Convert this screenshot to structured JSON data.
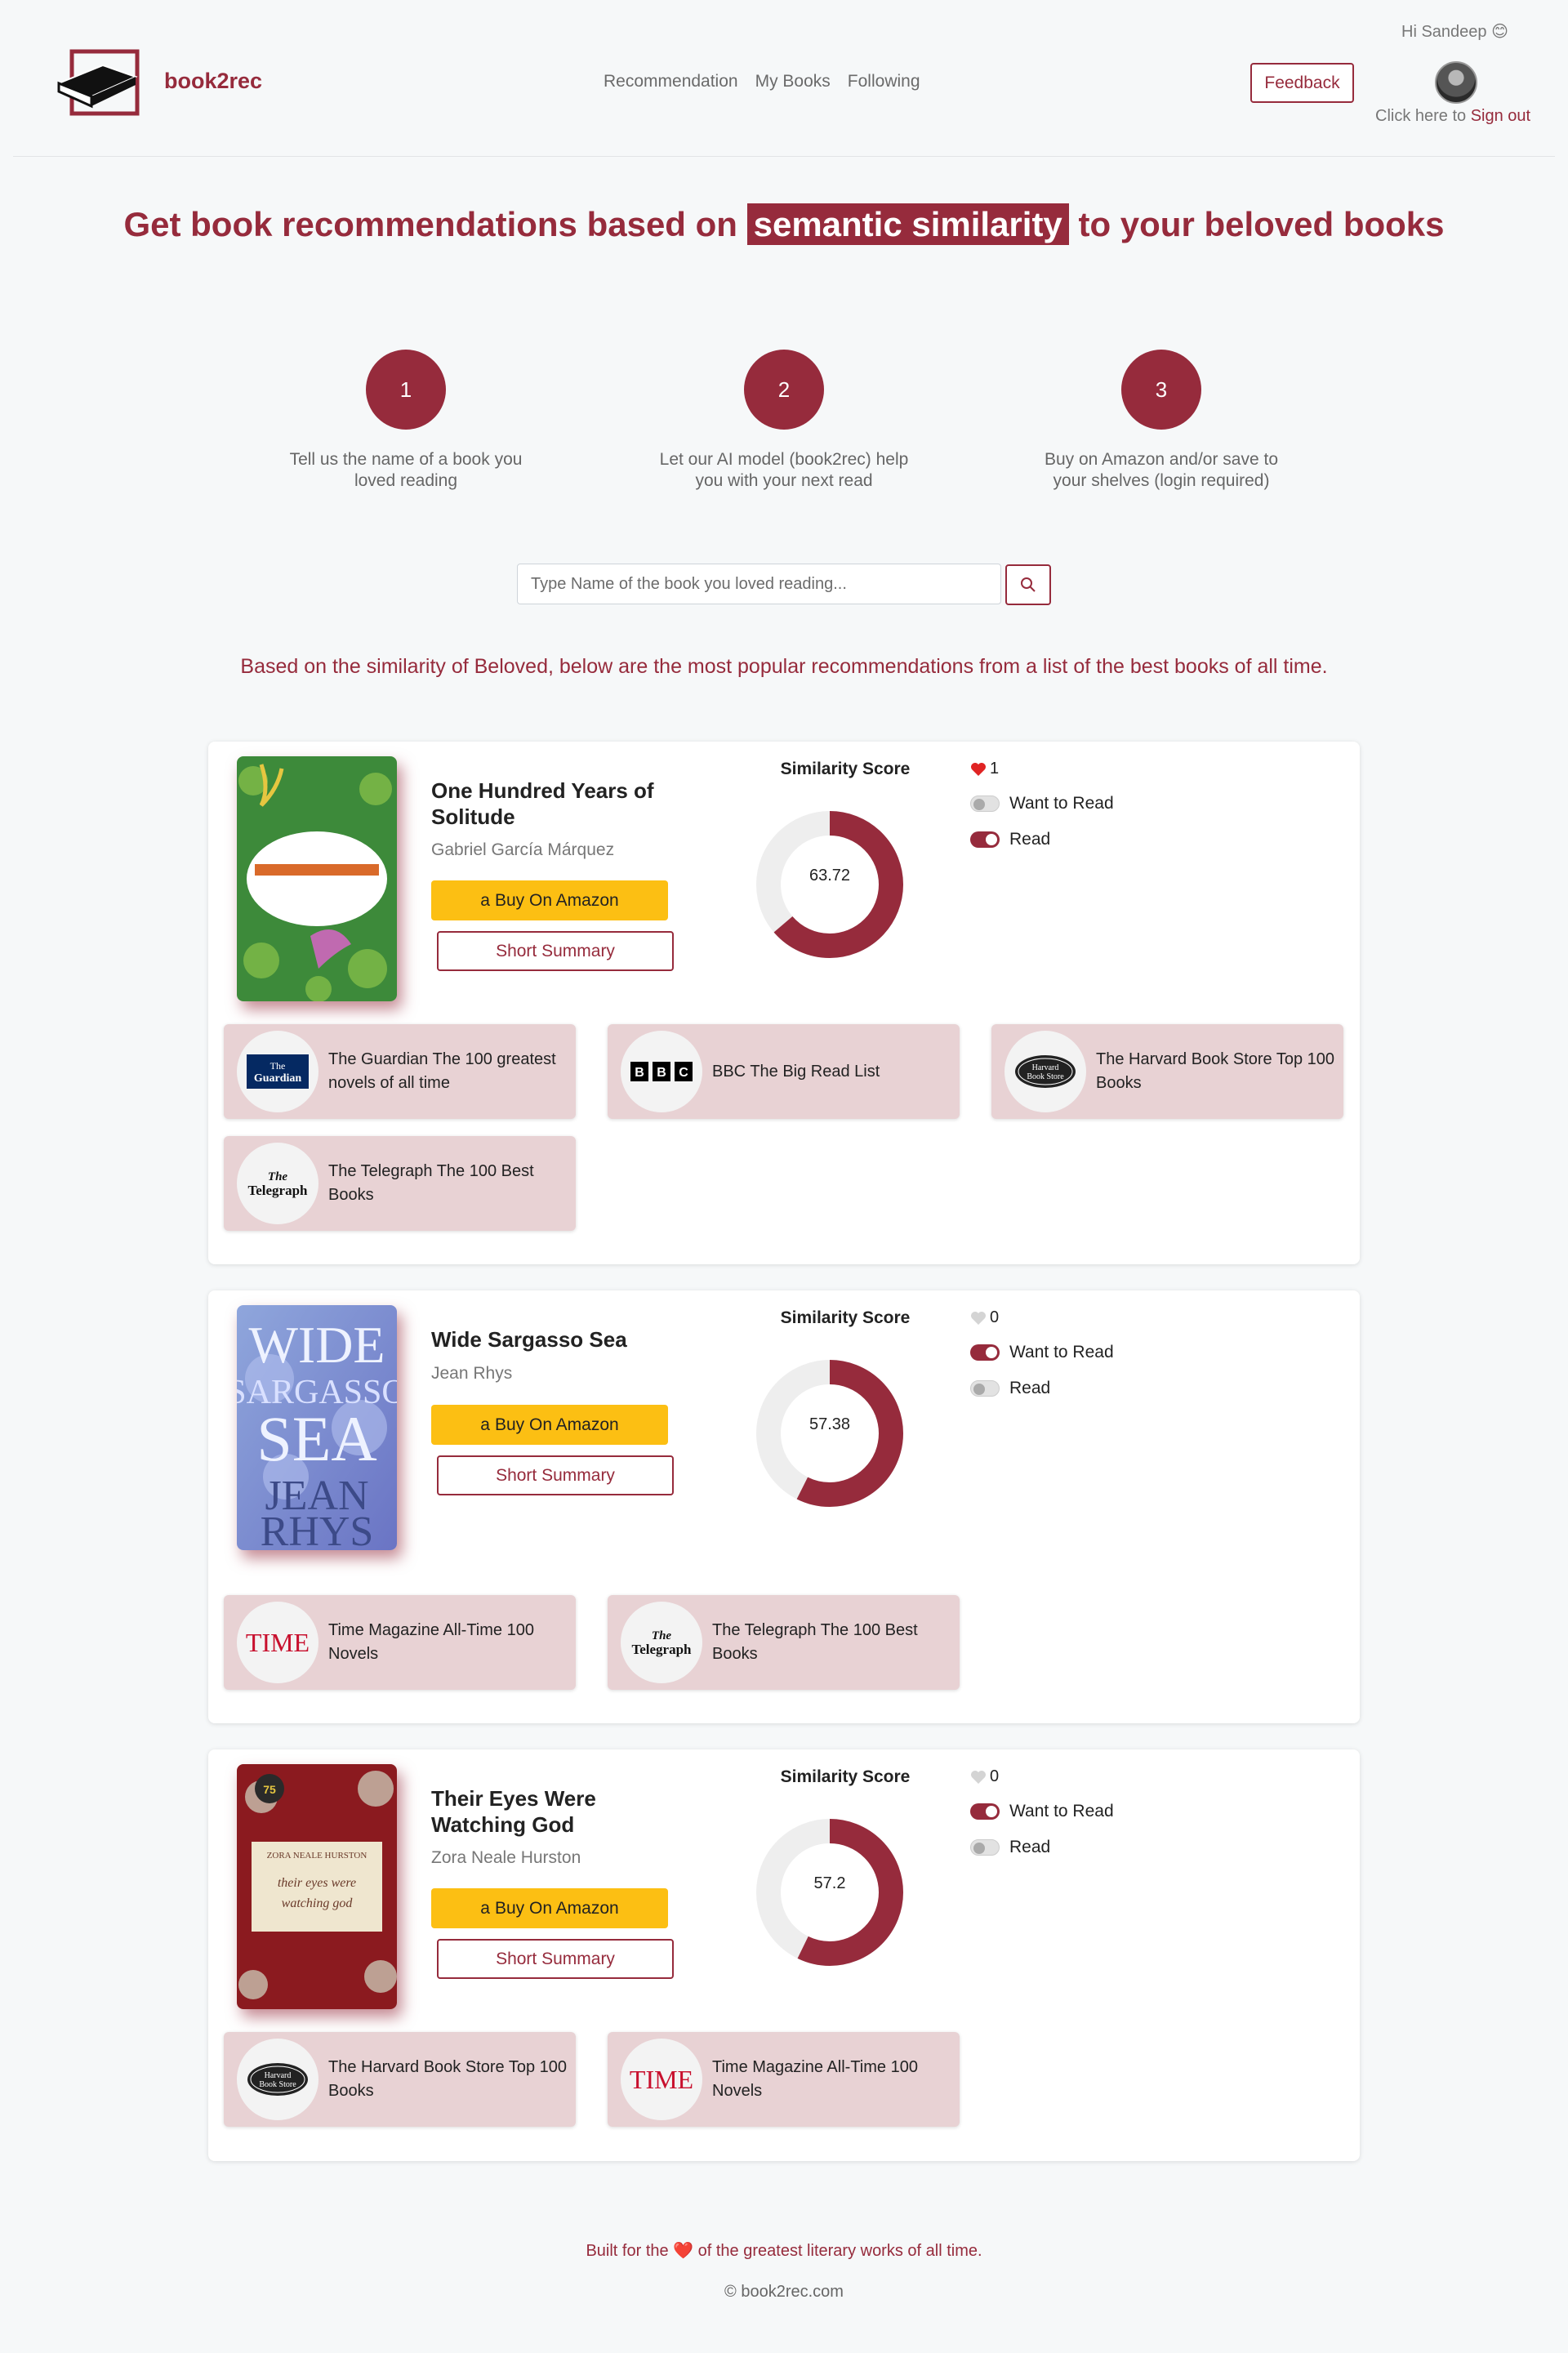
{
  "header": {
    "brand": "book2rec",
    "nav": [
      "Recommendation",
      "My Books",
      "Following"
    ],
    "greeting": "Hi Sandeep 😊",
    "feedback_label": "Feedback",
    "signout_prefix": "Click here to ",
    "signout_link": "Sign out"
  },
  "hero": {
    "title_before": "Get book recommendations based on ",
    "title_highlight": "semantic similarity",
    "title_after": " to your beloved books",
    "steps": [
      {
        "number": "1",
        "text": "Tell us the name of a book you loved reading"
      },
      {
        "number": "2",
        "text": "Let our AI model (book2rec) help you with your next read"
      },
      {
        "number": "3",
        "text": "Buy on Amazon and/or save to your shelves (login required)"
      }
    ]
  },
  "search": {
    "placeholder": "Type Name of the book you loved reading..."
  },
  "based_text": "Based on the similarity of Beloved, below are the most popular recommendations from a list of the best books of all time.",
  "labels": {
    "similarity": "Similarity Score",
    "buy": "Buy On Amazon",
    "summary": "Short Summary",
    "want": "Want to Read",
    "read": "Read"
  },
  "books": [
    {
      "title": "One Hundred Years of Solitude",
      "author": "Gabriel García Márquez",
      "score": 63.72,
      "likes": "1",
      "liked": true,
      "want_to_read": false,
      "read": true,
      "lists": [
        {
          "name": "The Guardian The 100 greatest novels of all time",
          "logo": "guardian-logo"
        },
        {
          "name": "BBC The Big Read List",
          "logo": "bbc-logo"
        },
        {
          "name": "The Harvard Book Store Top 100 Books",
          "logo": "harvard-logo"
        },
        {
          "name": "The Telegraph The 100 Best Books",
          "logo": "telegraph-logo"
        }
      ]
    },
    {
      "title": "Wide Sargasso Sea",
      "author": "Jean Rhys",
      "score": 57.38,
      "likes": "0",
      "liked": false,
      "want_to_read": true,
      "read": false,
      "lists": [
        {
          "name": "Time Magazine All-Time 100 Novels",
          "logo": "time-logo"
        },
        {
          "name": "The Telegraph The 100 Best Books",
          "logo": "telegraph-logo"
        }
      ]
    },
    {
      "title": "Their Eyes Were Watching God",
      "author": "Zora Neale Hurston",
      "score": 57.2,
      "likes": "0",
      "liked": false,
      "want_to_read": true,
      "read": false,
      "lists": [
        {
          "name": "The Harvard Book Store Top 100 Books",
          "logo": "harvard-logo"
        },
        {
          "name": "Time Magazine All-Time 100 Novels",
          "logo": "time-logo"
        }
      ]
    }
  ],
  "footer": {
    "built_prefix": "Built for the ",
    "built_suffix": " of the greatest literary works of all time.",
    "copyright": "© book2rec.com"
  },
  "colors": {
    "accent": "#962b3c",
    "amazon": "#fcbf13",
    "chip": "#e8d2d4"
  }
}
